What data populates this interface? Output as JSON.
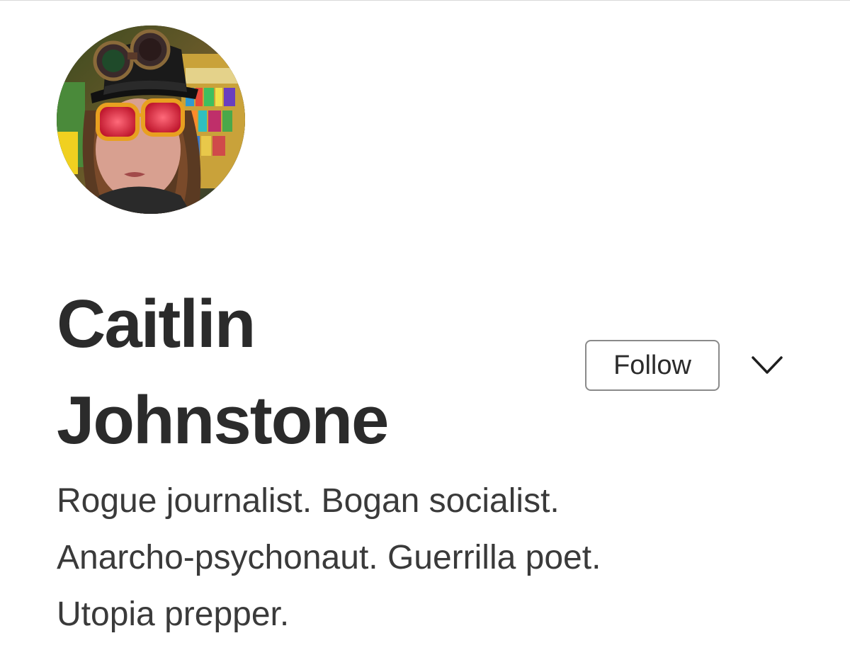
{
  "profile": {
    "avatar_alt": "avatar-photo",
    "name_line1": "Caitlin",
    "name_line2": "Johnstone",
    "bio_lines": [
      "Rogue journalist. Bogan socialist.",
      "Anarcho-psychonaut. Guerrilla poet.",
      "Utopia prepper."
    ]
  },
  "actions": {
    "follow_label": "Follow",
    "more_icon": "chevron-down-icon"
  },
  "colors": {
    "text": "#2b2b2b",
    "button_border": "#8a8a8a",
    "background": "#ffffff"
  }
}
